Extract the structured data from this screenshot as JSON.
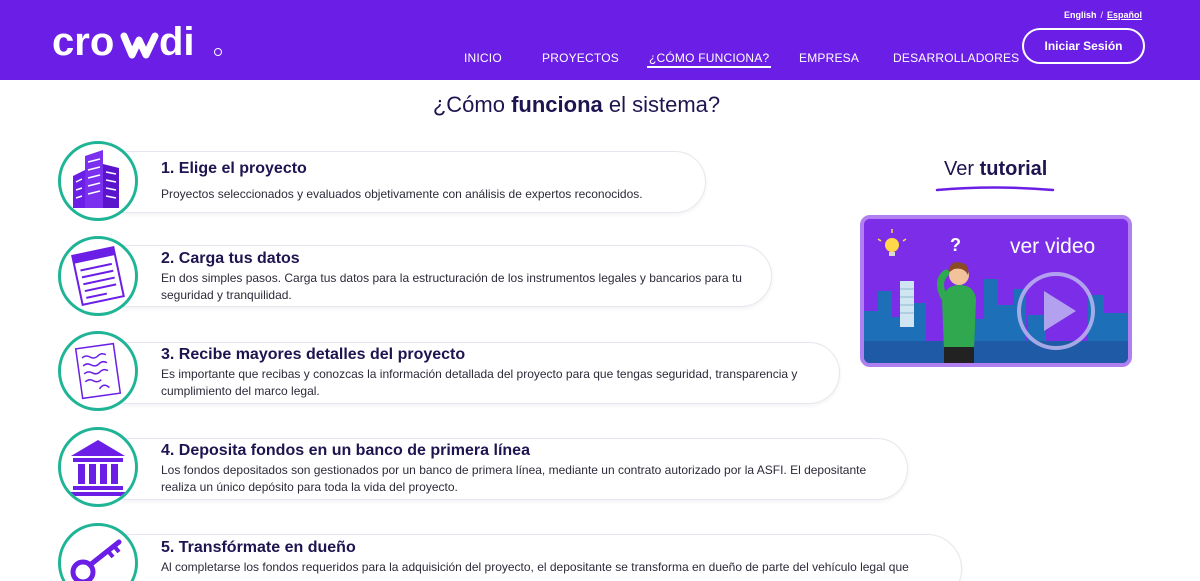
{
  "header": {
    "brand": "crowdi",
    "lang": {
      "english": "English",
      "separator": "/",
      "spanish": "Español"
    },
    "nav": [
      {
        "label": "INICIO"
      },
      {
        "label": "PROYECTOS"
      },
      {
        "label": "¿CÓMO FUNCIONA?"
      },
      {
        "label": "EMPRESA"
      },
      {
        "label": "DESARROLLADORES"
      }
    ],
    "login_label": "Iniciar Sesión",
    "colors": {
      "primary": "#6b1ee6",
      "accent": "#20b496"
    }
  },
  "page": {
    "title_prefix": "¿Cómo ",
    "title_bold": "funciona",
    "title_suffix": " el sistema?"
  },
  "steps": [
    {
      "title": "1.  Elige el proyecto",
      "desc": "Proyectos seleccionados y evaluados objetivamente con análisis de expertos reconocidos.",
      "icon": "buildings-icon"
    },
    {
      "title": "2.  Carga tus datos",
      "desc": "En dos simples pasos. Carga tus datos para la estructuración de los instrumentos legales y bancarios para tu seguridad y tranquilidad.",
      "icon": "form-document-icon"
    },
    {
      "title": "3.  Recibe mayores detalles del proyecto",
      "desc": "Es importante que recibas y conozcas la información detallada del proyecto para que tengas seguridad, transparencia y cumplimiento del marco legal.",
      "icon": "contract-document-icon"
    },
    {
      "title": "4.  Deposita fondos en un banco de primera línea",
      "desc": "Los fondos depositados son gestionados por un banco de primera línea, mediante un contrato autorizado por la ASFI. El depositante realiza un único depósito para toda la vida del proyecto.",
      "icon": "bank-icon"
    },
    {
      "title": "5.  Transfórmate en dueño",
      "desc": "Al completarse los fondos requeridos para la adquisición del proyecto, el depositante se transforma en dueño de parte del vehículo legal que",
      "icon": "key-icon"
    }
  ],
  "tutorial": {
    "title_prefix": "Ver ",
    "title_bold": "tutorial",
    "video_label": "ver video"
  }
}
